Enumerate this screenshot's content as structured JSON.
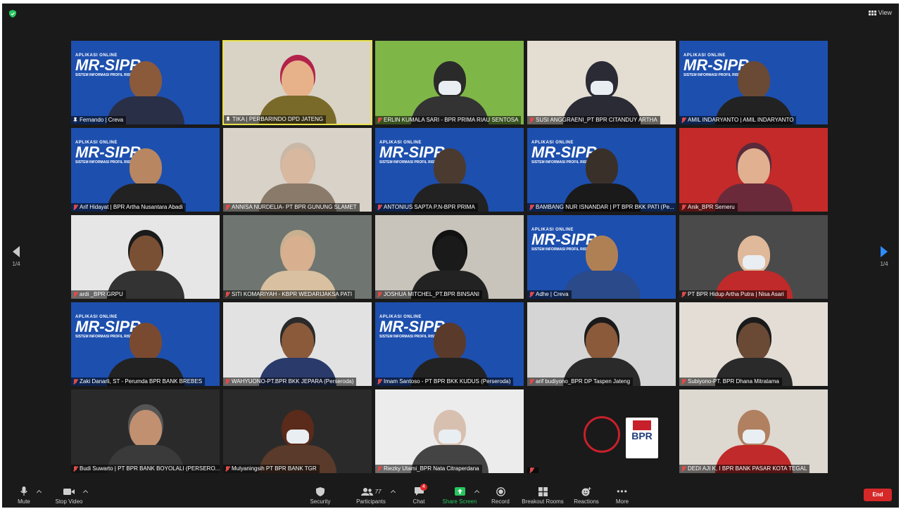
{
  "header": {
    "view_label": "View"
  },
  "pagination": {
    "left": "1/4",
    "right": "1/4"
  },
  "participants_tiles": [
    {
      "name": "Fernando | Creva",
      "icon": "pin-icon",
      "bg": "#1d4fae",
      "kind": "banner",
      "skin": "#8a5a3a",
      "shirt": "#2a2f48"
    },
    {
      "name": "TIKA | PERBARINDO DPD JATENG",
      "icon": "pin-icon",
      "bg": "#d9d3c6",
      "kind": "person",
      "active": true,
      "skin": "#e7b28a",
      "hair": "#b2224a",
      "shirt": "#7a6a2a"
    },
    {
      "name": "ERLIN KUMALA SARI - BPR PRIMA RIAU SENTOSA",
      "icon": "mic-off-icon",
      "bg": "#7fb648",
      "kind": "mask",
      "skin": "#2a2a2a",
      "shirt": "#333333"
    },
    {
      "name": "SUSI ANGGRAENI_PT BPR CITANDUY ARTHA",
      "icon": "mic-off-icon",
      "bg": "#e4ddd1",
      "kind": "mask",
      "skin": "#2b2b36",
      "shirt": "#2b2b36"
    },
    {
      "name": "AMIL INDARYANTO | AMIL INDARYANTO",
      "icon": "mic-off-icon",
      "bg": "#1d4fae",
      "kind": "banner",
      "skin": "#6a4a35",
      "shirt": "#222"
    },
    {
      "name": "Arif Hidayat | BPR Artha Nusantara Abadi",
      "icon": "mic-off-icon",
      "bg": "#1d4fae",
      "kind": "banner",
      "skin": "#b88660",
      "shirt": "#222"
    },
    {
      "name": "ANNISA NURDELIA- PT BPR GUNUNG SLAMET",
      "icon": "mic-off-icon",
      "bg": "#d8d2c8",
      "kind": "person",
      "skin": "#d9b8a0",
      "hair": "#c9b8a5",
      "shirt": "#8a7a6a"
    },
    {
      "name": "ANTONIUS SAPTA P.N-BPR PRIMA",
      "icon": "mic-off-icon",
      "bg": "#1d4fae",
      "kind": "banner",
      "skin": "#4a3a30",
      "shirt": "#222"
    },
    {
      "name": "BAMBANG NUR ISNANDAR | PT BPR BKK PATI (Pe...",
      "icon": "mic-off-icon",
      "bg": "#1d4fae",
      "kind": "banner",
      "skin": "#3a302a",
      "shirt": "#1a1a1a"
    },
    {
      "name": "Anik_BPR Semeru",
      "icon": "mic-off-icon",
      "bg": "#c42a2a",
      "kind": "person",
      "skin": "#e0b090",
      "hair": "#5a2a3a",
      "shirt": "#6a2a3a"
    },
    {
      "name": "ardi _BPR GRPU",
      "icon": "mic-off-icon",
      "bg": "#e6e6e6",
      "kind": "person",
      "skin": "#7a5035",
      "hair": "#1a1a1a",
      "shirt": "#333"
    },
    {
      "name": "SITI KOMARIYAH - KBPR WEDARIJAKSA PATI",
      "icon": "mic-off-icon",
      "bg": "#6f7570",
      "kind": "person",
      "skin": "#d8b090",
      "hair": "#c8b090",
      "shirt": "#d8c0a0"
    },
    {
      "name": "JOSHUA MITCHEL_PT.BPR BINSANI",
      "icon": "mic-off-icon",
      "bg": "#c8c4bc",
      "kind": "person",
      "skin": "#1a1a1a",
      "hair": "#111",
      "shirt": "#222"
    },
    {
      "name": "Adhe | Creva",
      "icon": "mic-off-icon",
      "bg": "#1d4fae",
      "kind": "banner",
      "skin": "#b08055",
      "shirt": "#2a4a8a"
    },
    {
      "name": "PT BPR Hidup Artha Putra | Nisa Asari",
      "icon": "mic-off-icon",
      "bg": "#4a4a4a",
      "kind": "mask",
      "skin": "#e0b89a",
      "shirt": "#c02a2a"
    },
    {
      "name": "Zaki Danarli, ST - Perumda BPR BANK BREBES",
      "icon": "mic-off-icon",
      "bg": "#1d4fae",
      "kind": "banner",
      "skin": "#7a4a30",
      "shirt": "#222"
    },
    {
      "name": "WAHYUONO-PT.BPR BKK JEPARA (Perseroda)",
      "icon": "mic-off-icon",
      "bg": "#e2e2e2",
      "kind": "person",
      "skin": "#8a5a3a",
      "hair": "#2a2a2a",
      "shirt": "#2a3a6a"
    },
    {
      "name": "Imam Santoso - PT BPR BKK KUDUS (Perseroda)",
      "icon": "mic-off-icon",
      "bg": "#1d4fae",
      "kind": "banner",
      "skin": "#5a3a2a",
      "shirt": "#222"
    },
    {
      "name": "arif budiyono_BPR DP Taspen Jateng",
      "icon": "mic-off-icon",
      "bg": "#d5d5d5",
      "kind": "person",
      "skin": "#8a5a3a",
      "hair": "#1a1a1a",
      "shirt": "#2a2a2a"
    },
    {
      "name": "Subiyono-PT. BPR Dhana Mitratama",
      "icon": "mic-off-icon",
      "bg": "#e3ddd5",
      "kind": "person",
      "skin": "#6a4a35",
      "hair": "#1a1a1a",
      "shirt": "#2a2a2a"
    },
    {
      "name": "Budi Suwarto | PT BPR BANK BOYOLALI (PERSERO...",
      "icon": "mic-off-icon",
      "bg": "#2a2a2a",
      "kind": "person",
      "skin": "#c09070",
      "hair": "#555",
      "shirt": "#3a3a3a"
    },
    {
      "name": "Mulyaningsih PT BPR BANK TGR",
      "icon": "mic-off-icon",
      "bg": "#2a2a2a",
      "kind": "mask",
      "skin": "#5a2a1a",
      "shirt": "#5a3a2a"
    },
    {
      "name": "Riezky Utami_BPR Nata Citraperdana",
      "icon": "mic-off-icon",
      "bg": "#ececec",
      "kind": "mask",
      "skin": "#d8c0b0",
      "shirt": "#444"
    },
    {
      "name": "",
      "icon": "mic-off-icon",
      "bg": "#1a1a1a",
      "kind": "logo",
      "logo_text": "BPR"
    },
    {
      "name": "DEDI AJI K, I BPR BANK PASAR KOTA TEGAL",
      "icon": "mic-off-icon",
      "bg": "#ddd8d0",
      "kind": "mask",
      "skin": "#b08060",
      "shirt": "#c02a2a"
    }
  ],
  "banner_text": {
    "top": "APLIKASI ONLINE",
    "main": "MR-SIPRo",
    "sub": "SISTEM INFORMASI PROFIL RISIKO"
  },
  "toolbar": {
    "mute": "Mute",
    "stop_video": "Stop Video",
    "security": "Security",
    "participants": "Participants",
    "participants_count": "77",
    "chat": "Chat",
    "chat_badge": "4",
    "share_screen": "Share Screen",
    "record": "Record",
    "breakout": "Breakout Rooms",
    "reactions": "Reactions",
    "more": "More",
    "end": "End"
  },
  "colors": {
    "accent_green": "#27c55e",
    "end_red": "#d62828",
    "active_speaker": "#e8e24a",
    "nav_blue": "#2e8cff"
  }
}
